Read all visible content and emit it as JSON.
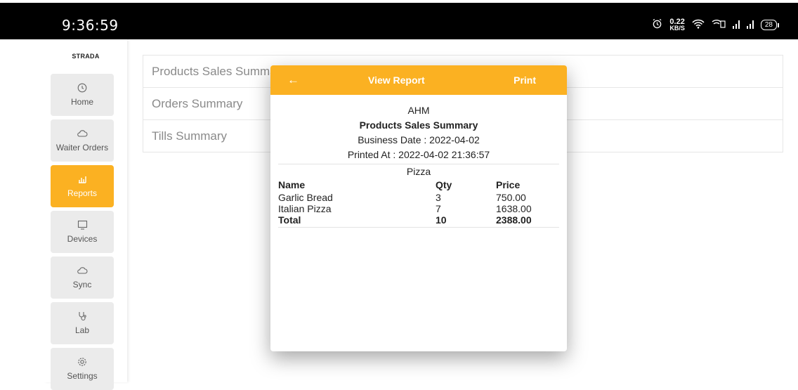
{
  "status_bar": {
    "time": "9:36:59",
    "net_speed_value": "0.22",
    "net_speed_unit": "KB/S",
    "battery": "28",
    "icons": [
      "alarm-icon",
      "wifi-icon",
      "volte-icon",
      "signal-icon",
      "signal-icon",
      "battery-icon"
    ]
  },
  "sidebar": {
    "brand": "STRADA",
    "items": [
      {
        "label": "Home",
        "icon": "clock-icon",
        "active": false
      },
      {
        "label": "Waiter Orders",
        "icon": "cloud-icon",
        "active": false
      },
      {
        "label": "Reports",
        "icon": "bar-chart-icon",
        "active": true
      },
      {
        "label": "Devices",
        "icon": "monitor-icon",
        "active": false
      },
      {
        "label": "Sync",
        "icon": "cloud-sync-icon",
        "active": false
      },
      {
        "label": "Lab",
        "icon": "stethoscope-icon",
        "active": false
      },
      {
        "label": "Settings",
        "icon": "gear-icon",
        "active": false
      }
    ]
  },
  "report_list": [
    "Products Sales Summary",
    "Orders Summary",
    "Tills Summary"
  ],
  "dialog": {
    "back_icon": "arrow-left-icon",
    "title": "View Report",
    "print_label": "Print",
    "report": {
      "company": "AHM",
      "heading": "Products Sales Summary",
      "business_date": "Business Date : 2022-04-02",
      "printed_at": "Printed At : 2022-04-02 21:36:57",
      "group": "Pizza",
      "columns": [
        "Name",
        "Qty",
        "Price"
      ],
      "rows": [
        [
          "Garlic Bread",
          "3",
          "750.00"
        ],
        [
          "Italian Pizza",
          "7",
          "1638.00"
        ]
      ],
      "total": [
        "Total",
        "10",
        "2388.00"
      ]
    }
  },
  "colors": {
    "accent": "#fbb122",
    "statusbar": "#000000",
    "nav_inactive": "#ebebeb"
  }
}
